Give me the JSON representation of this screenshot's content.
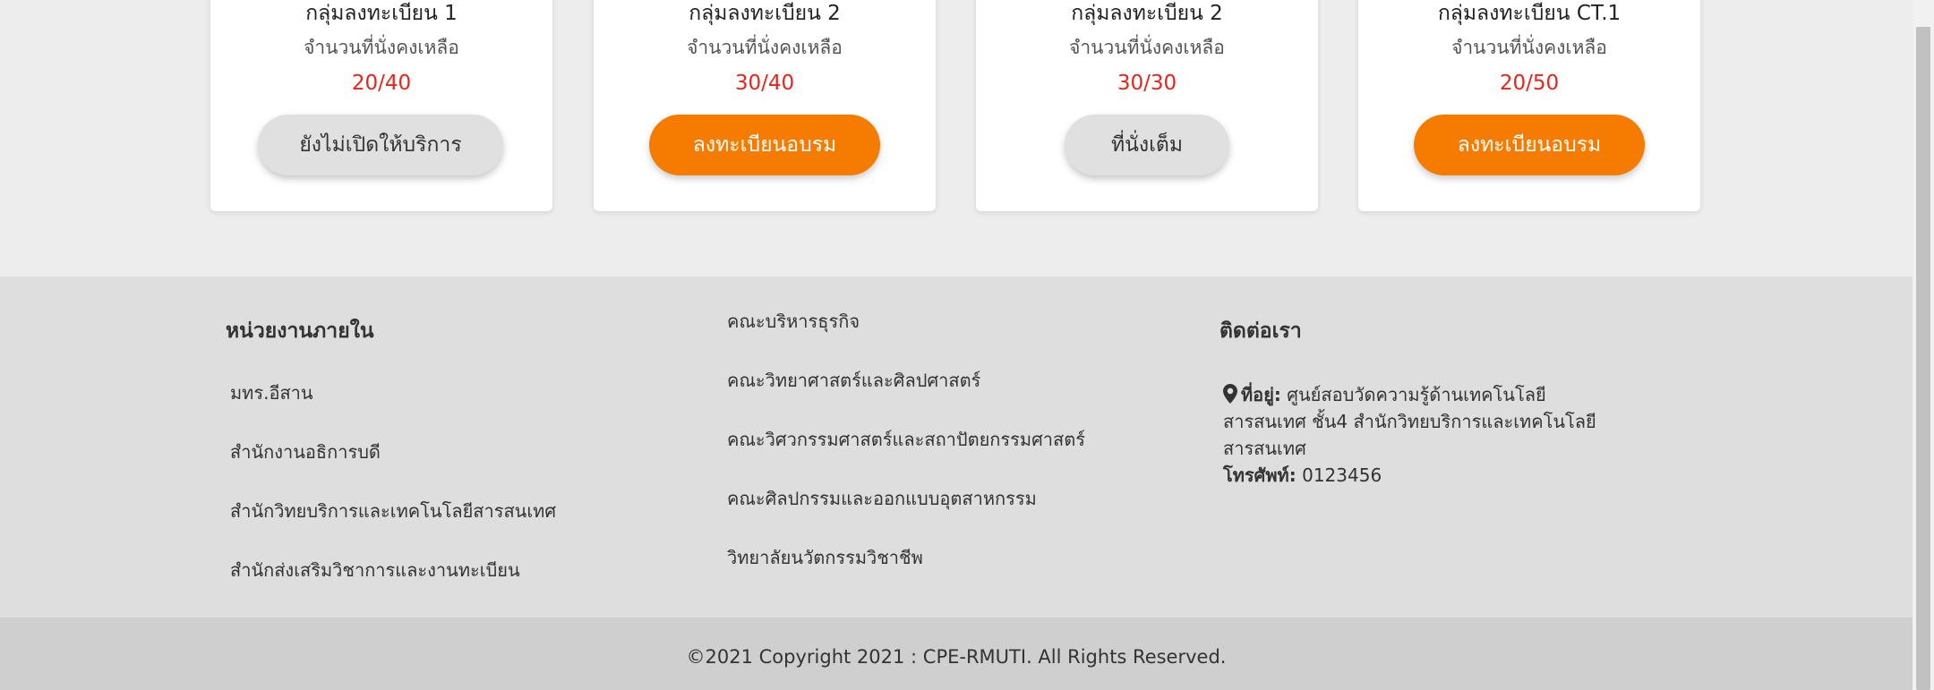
{
  "cards": [
    {
      "title": "กลุ่มลงทะเบียน 1",
      "subtitle": "จำนวนที่นั่งคงเหลือ",
      "seats": "20/40",
      "button": "ยังไม่เปิดให้บริการ",
      "button_style": "gray"
    },
    {
      "title": "กลุ่มลงทะเบียน 2",
      "subtitle": "จำนวนที่นั่งคงเหลือ",
      "seats": "30/40",
      "button": "ลงทะเบียนอบรม",
      "button_style": "orange"
    },
    {
      "title": "กลุ่มลงทะเบียน 2",
      "subtitle": "จำนวนที่นั่งคงเหลือ",
      "seats": "30/30",
      "button": "ที่นั่งเต็ม",
      "button_style": "gray"
    },
    {
      "title": "กลุ่มลงทะเบียน CT.1",
      "subtitle": "จำนวนที่นั่งคงเหลือ",
      "seats": "20/50",
      "button": "ลงทะเบียนอบรม",
      "button_style": "orange"
    }
  ],
  "footer": {
    "internal": {
      "heading": "หน่วยงานภายใน",
      "links": [
        "มทร.อีสาน",
        "สำนักงานอธิการบดี",
        "สำนักวิทยบริการและเทคโนโลยีสารสนเทศ",
        "สำนักส่งเสริมวิชาการและงานทะเบียน"
      ]
    },
    "faculties": {
      "links": [
        "คณะบริหารธุรกิจ",
        "คณะวิทยาศาสตร์และศิลปศาสตร์",
        "คณะวิศวกรรมศาสตร์และสถาปัตยกรรมศาสตร์",
        "คณะศิลปกรรมและออกแบบอุตสาหกรรม",
        "วิทยาลัยนวัตกรรมวิชาชีพ"
      ]
    },
    "contact": {
      "heading": "ติดต่อเรา",
      "address_label": "ที่อยู่:",
      "address_line1": "ศูนย์สอบวัดความรู้ด้านเทคโนโลยี",
      "address_line2": "สารสนเทศ ชั้น4 สำนักวิทยบริการและเทคโนโลยี",
      "address_line3": "สารสนเทศ",
      "phone_label": "โทรศัพท์:",
      "phone": "0123456"
    },
    "copyright": "©2021 Copyright 2021 : CPE-RMUTI. All Rights Reserved."
  },
  "colors": {
    "accent": "#f57c00",
    "seats": "#e8251c",
    "button_gray": "#e0e0e0",
    "footer_bg": "#dedede",
    "copyright_bg": "#cfcfcf"
  }
}
